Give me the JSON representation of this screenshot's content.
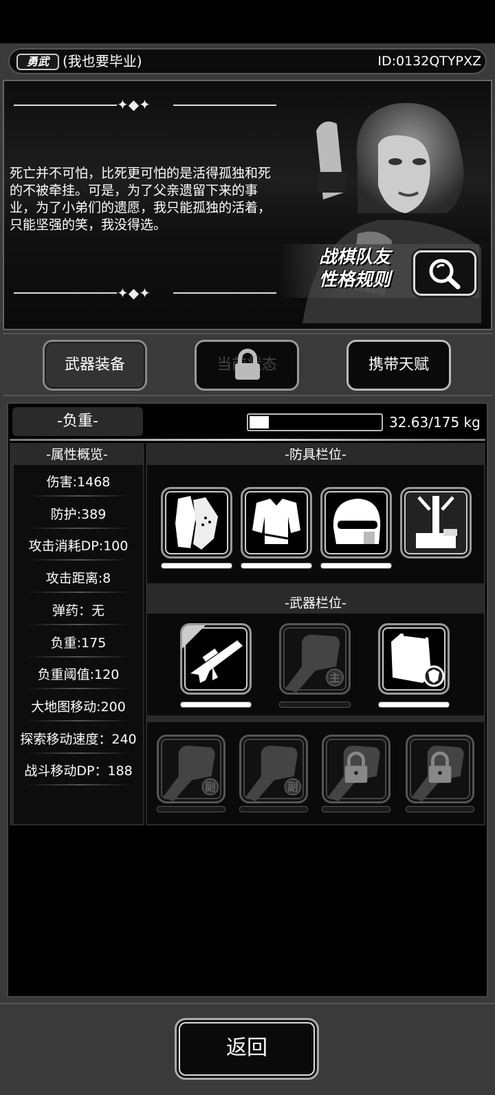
{
  "header": {
    "badge": "勇武",
    "player_name": "(我也要毕业)",
    "player_id": "ID:0132QTYPXZ"
  },
  "story": {
    "text": "死亡并不可怕，比死更可怕的是活得孤独和死的不被牵挂。可是，为了父亲遗留下来的事业，为了小弟们的遗愿，我只能孤独的活着，只能坚强的笑，我没得选。",
    "rule_button_text": "战棋队友\n性格规则"
  },
  "tabs": {
    "weapon": "武器装备",
    "status": "当前状态",
    "talent": "携带天赋"
  },
  "load": {
    "label": "-负重-",
    "value_text": "32.63/175 kg",
    "current": 32.63,
    "max": 175
  },
  "attributes": {
    "title": "-属性概览-",
    "items": [
      "伤害:1468",
      "防护:389",
      "攻击消耗DP:100",
      "攻击距离:8",
      "弹药：无",
      "负重:175",
      "负重阈值:120",
      "大地图移动:200",
      "探索移动速度：240",
      "战斗移动DP：188"
    ]
  },
  "armor": {
    "title": "-防具栏位-",
    "slots": [
      {
        "icon": "gloves-icon",
        "durability": 1.0
      },
      {
        "icon": "body-armor-icon",
        "durability": 1.0
      },
      {
        "icon": "helmet-icon",
        "durability": 1.0
      },
      {
        "icon": "backpack-icon",
        "durability": null
      }
    ]
  },
  "weapons": {
    "title": "-武器栏位-",
    "slots": [
      {
        "icon": "assault-rifle-icon",
        "durability": 1.0
      },
      {
        "icon": "fist-icon",
        "tag": "主",
        "durability": 0
      },
      {
        "icon": "shield-case-icon",
        "durability": 1.0
      }
    ],
    "secondary": [
      {
        "icon": "fist-icon",
        "tag": "副"
      },
      {
        "icon": "fist-icon",
        "tag": "副"
      },
      {
        "icon": "locked-fist-icon"
      },
      {
        "icon": "locked-fist-icon"
      }
    ]
  },
  "footer": {
    "back": "返回"
  }
}
